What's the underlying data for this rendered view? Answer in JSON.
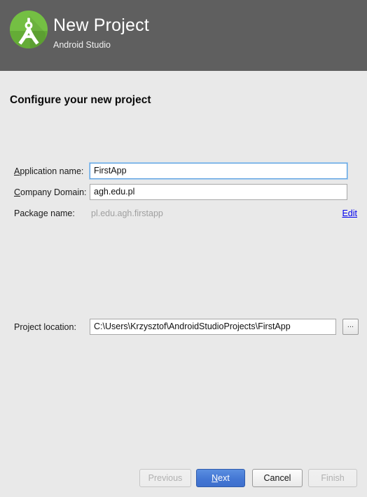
{
  "header": {
    "title": "New Project",
    "subtitle": "Android Studio",
    "logo_icon": "android-studio-logo-icon",
    "background_color": "#5f5f5f",
    "logo_color": "#6fbf3f"
  },
  "body": {
    "step_title": "Configure your new project",
    "background_color": "#e9e9e9"
  },
  "fields": {
    "application_name": {
      "label_mnemonic": "A",
      "label_rest": "pplication name:",
      "value": "FirstApp",
      "focused": true
    },
    "company_domain": {
      "label_mnemonic": "C",
      "label_rest": "ompany Domain:",
      "value": "agh.edu.pl",
      "focused": false
    },
    "package_name": {
      "label": "Package name:",
      "value": "pl.edu.agh.firstapp",
      "editable": false,
      "edit_link_label": "Edit",
      "edit_link_color": "#0000ee"
    },
    "project_location": {
      "label": "Project location:",
      "value": "C:\\Users\\Krzysztof\\AndroidStudioProjects\\FirstApp",
      "browse_button_label": "...",
      "focused": false
    }
  },
  "footer": {
    "buttons": [
      {
        "name": "previous",
        "label": "Previous",
        "state": "disabled"
      },
      {
        "name": "next",
        "label_mnemonic": "N",
        "label_rest": "ext",
        "state": "primary"
      },
      {
        "name": "cancel",
        "label": "Cancel",
        "state": "default"
      },
      {
        "name": "finish",
        "label": "Finish",
        "state": "disabled"
      }
    ],
    "primary_color": "#4477d4"
  }
}
